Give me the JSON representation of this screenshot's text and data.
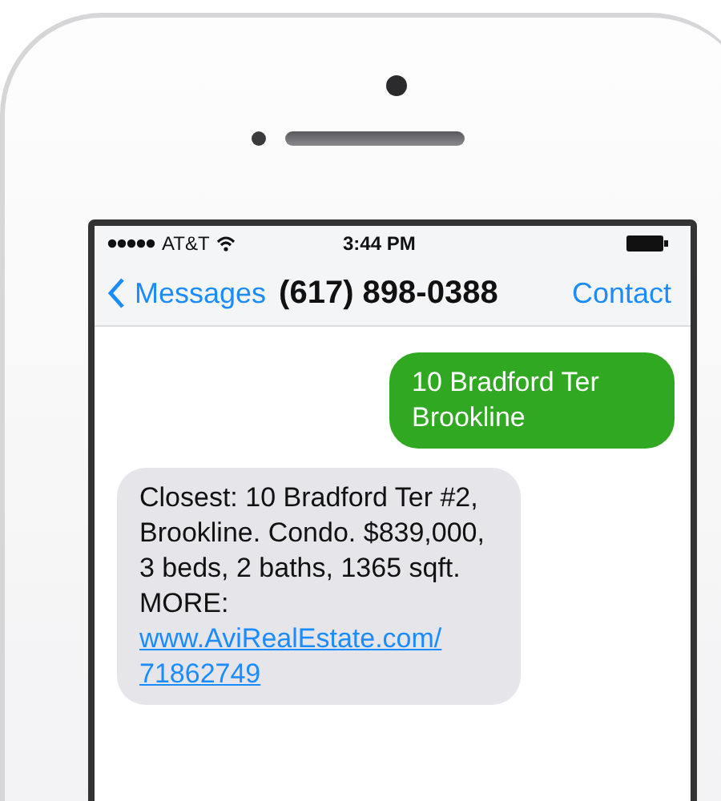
{
  "status_bar": {
    "carrier": "AT&T",
    "time": "3:44 PM"
  },
  "nav_bar": {
    "back_label": "Messages",
    "title": "(617) 898-0388",
    "action": "Contact"
  },
  "messages": [
    {
      "kind": "sent",
      "text": "10 Bradford Ter Brookline"
    },
    {
      "kind": "received",
      "text": "Closest: 10 Bradford Ter #2, Brookline. Condo. $839,000, 3 beds, 2 baths, 1365 sqft. MORE:",
      "link": "www.AviRealEstate.com/71862749"
    }
  ]
}
